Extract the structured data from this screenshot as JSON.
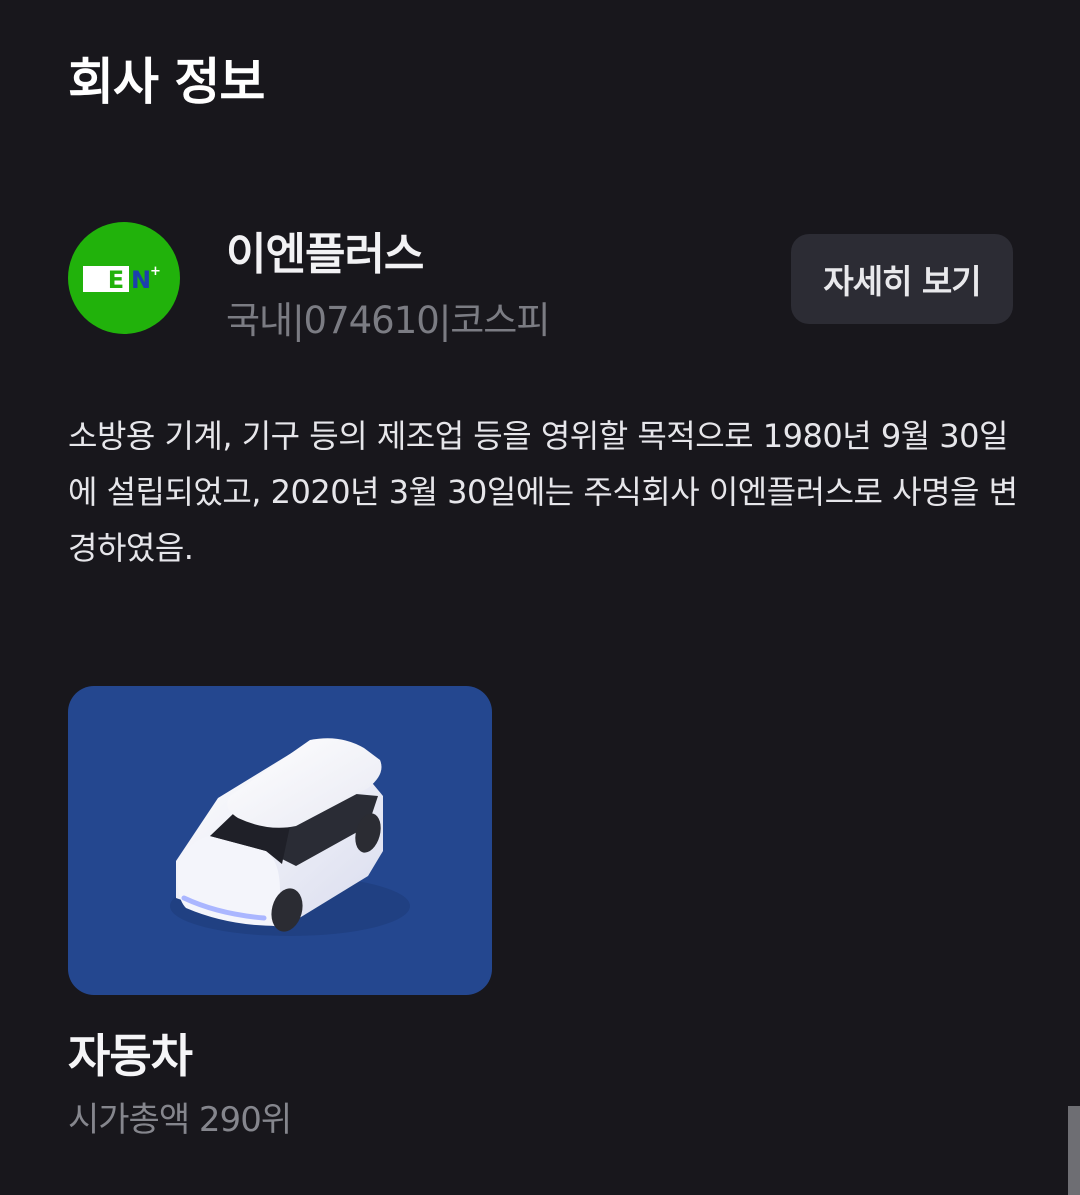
{
  "section": {
    "title": "회사 정보"
  },
  "company": {
    "name": "이엔플러스",
    "meta": "국내|074610|코스피",
    "logo_text": "EN",
    "logo_plus": "+",
    "logo_color": "#21b20b",
    "detail_button_label": "자세히 보기",
    "description": "소방용 기계, 기구 등의 제조업 등을 영위할 목적으로 1980년 9월 30일에 설립되었고, 2020년 3월 30일에는 주식회사 이엔플러스로 사명을 변경하였음."
  },
  "category": {
    "name": "자동차",
    "rank": "시가총액 290위",
    "icon": "car-icon",
    "card_color": "#24478f"
  },
  "colors": {
    "background": "#18171c",
    "button_background": "#2c2c34",
    "secondary_text": "#7b7c83"
  }
}
